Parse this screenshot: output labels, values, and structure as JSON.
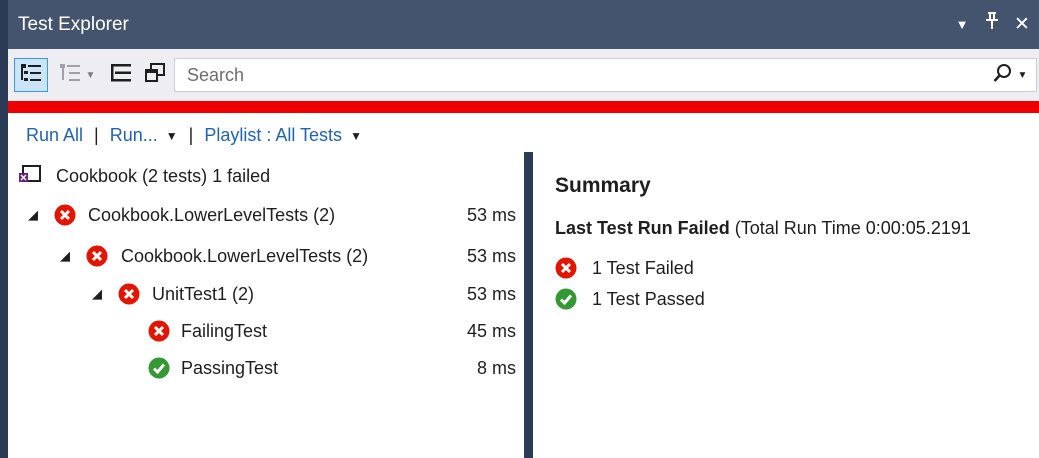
{
  "window": {
    "title": "Test Explorer",
    "controls": {
      "dropdown": "▼",
      "pin": "⊥",
      "close": "✕"
    }
  },
  "toolbar": {
    "search_placeholder": "Search",
    "search_icon": "search-icon"
  },
  "colors": {
    "titlebar": "#44546f",
    "frame": "#2b3a55",
    "fail": "#e51400",
    "pass": "#339933",
    "link": "#1e63b4",
    "status_bar": "#ee0000"
  },
  "commands": {
    "run_all": "Run All",
    "run": "Run...",
    "playlist": "Playlist : All Tests"
  },
  "tree": {
    "root": "Cookbook (2 tests) 1 failed",
    "rows": [
      {
        "label": "Cookbook.LowerLevelTests (2)",
        "duration": "53 ms",
        "status": "failed"
      },
      {
        "label": "Cookbook.LowerLevelTests (2)",
        "duration": "53 ms",
        "status": "failed"
      },
      {
        "label": "UnitTest1 (2)",
        "duration": "53 ms",
        "status": "failed"
      },
      {
        "label": "FailingTest",
        "duration": "45 ms",
        "status": "failed"
      },
      {
        "label": "PassingTest",
        "duration": "8 ms",
        "status": "passed"
      }
    ]
  },
  "summary": {
    "title": "Summary",
    "headline": "Last Test Run Failed",
    "run_time": "(Total Run Time 0:00:05.2191",
    "failed": "1 Test Failed",
    "passed": "1 Test Passed"
  }
}
